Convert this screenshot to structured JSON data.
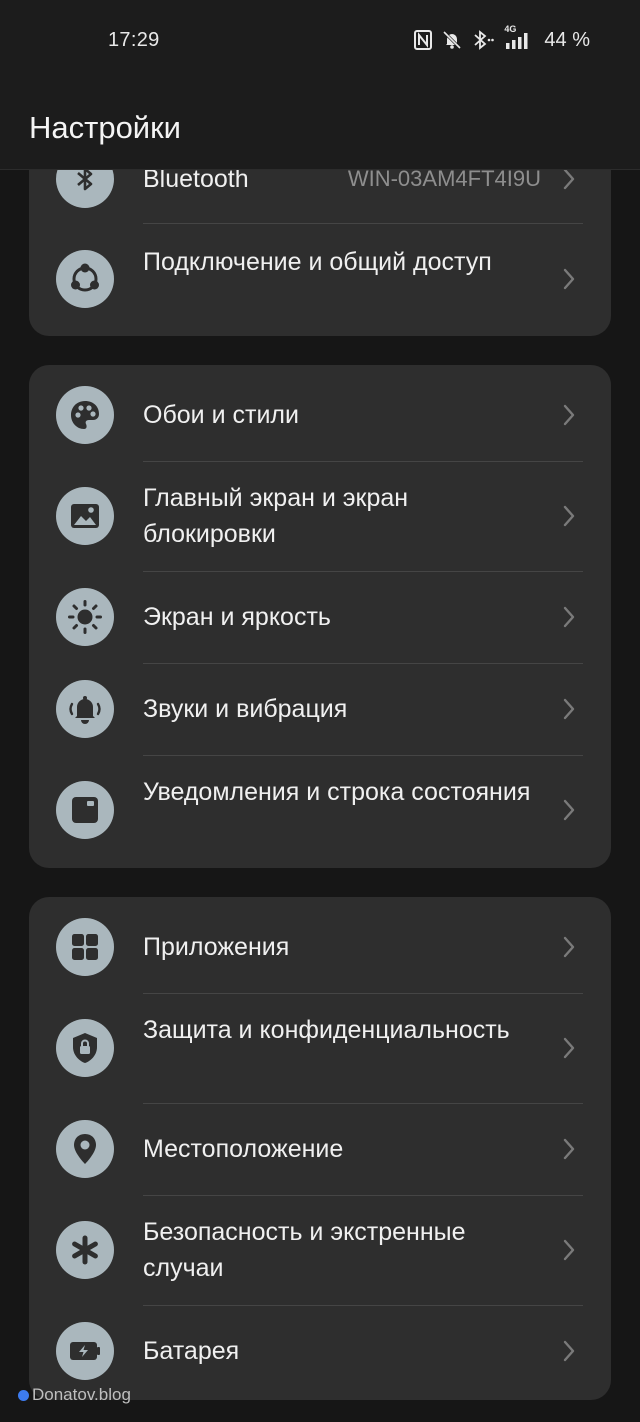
{
  "status_bar": {
    "time": "17:29",
    "battery": "44 %",
    "network": "4G",
    "icons": [
      "nfc-icon",
      "mute-notifications-icon",
      "bluetooth-icon",
      "signal-4g-icon"
    ]
  },
  "header": {
    "title": "Настройки"
  },
  "groups": [
    {
      "items": [
        {
          "label": "Bluetooth",
          "value": "WIN-03AM4FT4I9U",
          "icon": "bluetooth-icon"
        },
        {
          "label": "Подключение и общий доступ",
          "icon": "share-connection-icon"
        }
      ]
    },
    {
      "items": [
        {
          "label": "Обои и стили",
          "icon": "palette-icon"
        },
        {
          "label": "Главный экран и экран блокировки",
          "icon": "image-icon"
        },
        {
          "label": "Экран и яркость",
          "icon": "brightness-icon"
        },
        {
          "label": "Звуки и вибрация",
          "icon": "bell-vibrate-icon"
        },
        {
          "label": "Уведомления и строка состояния",
          "icon": "notification-icon"
        }
      ]
    },
    {
      "items": [
        {
          "label": "Приложения",
          "icon": "apps-grid-icon"
        },
        {
          "label": "Защита и конфиденциальность",
          "icon": "shield-lock-icon"
        },
        {
          "label": "Местоположение",
          "icon": "location-pin-icon"
        },
        {
          "label": "Безопасность и экстренные случаи",
          "icon": "emergency-asterisk-icon"
        },
        {
          "label": "Батарея",
          "icon": "battery-charging-icon"
        }
      ]
    }
  ],
  "watermark": "Donatov.blog",
  "colors": {
    "background": "#161616",
    "card": "#2e2e2e",
    "icon_circle": "#aab7bd",
    "text": "#f0f0f0"
  }
}
